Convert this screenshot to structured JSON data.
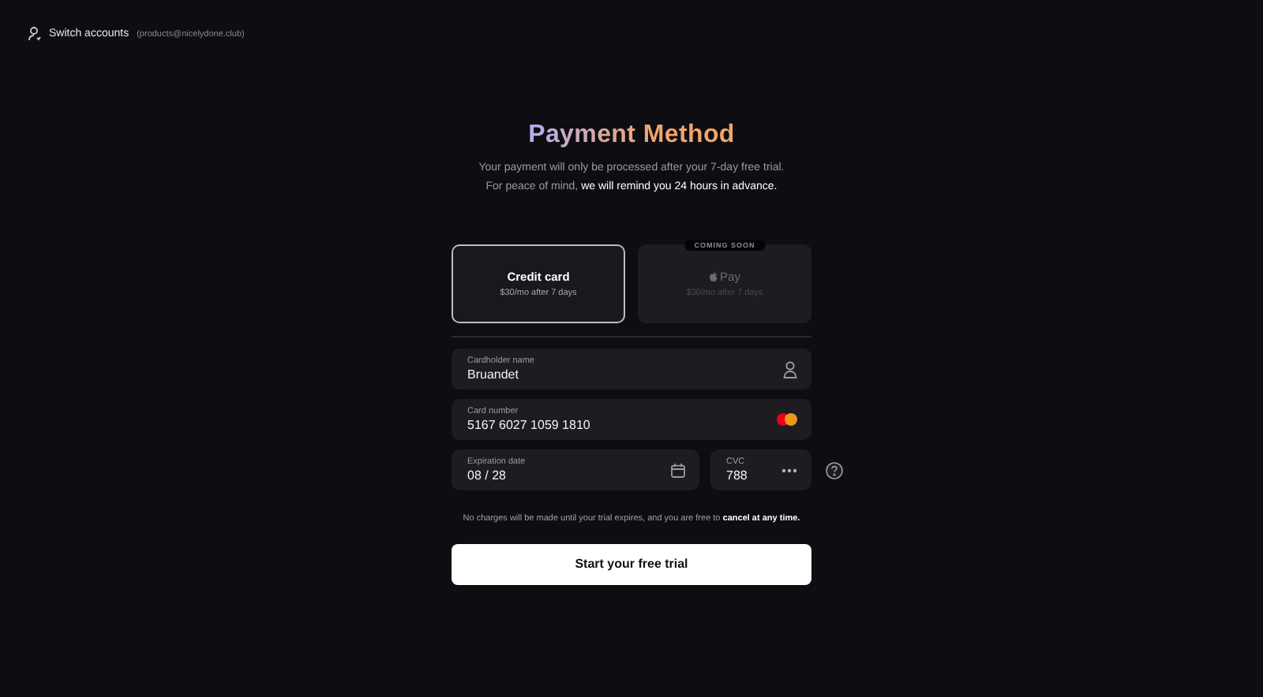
{
  "header": {
    "label": "Switch accounts",
    "email": "(products@nicelydone.club)"
  },
  "title": "Payment Method",
  "subtitle": {
    "line_1": "Your payment will only be processed after your 7-day free trial.",
    "line_2": "For peace of mind, **we will remind you 24 hours in advance.**"
  },
  "methods": [
    {
      "kind": "card",
      "label": "Credit card",
      "price": "$30/mo after 7 days",
      "selected": true,
      "disabled": false
    },
    {
      "kind": "applepay",
      "label": "Pay",
      "price": "$30/mo after 7 days",
      "selected": false,
      "disabled": true,
      "badge": "COMING SOON"
    }
  ],
  "fields": [
    {
      "label": "Cardholder name",
      "value": "Bruandet"
    },
    {
      "label": "Card number",
      "value": "5167 6027 1059 1810"
    }
  ],
  "expiry": {
    "label": "Expiration date",
    "value": "08 / 28"
  },
  "cvc": {
    "label": "CVC",
    "value": "788"
  },
  "note": "No charges will be made until your trial expires, and you are free to **cancel at any time.**",
  "submit": "Start your free trial"
}
